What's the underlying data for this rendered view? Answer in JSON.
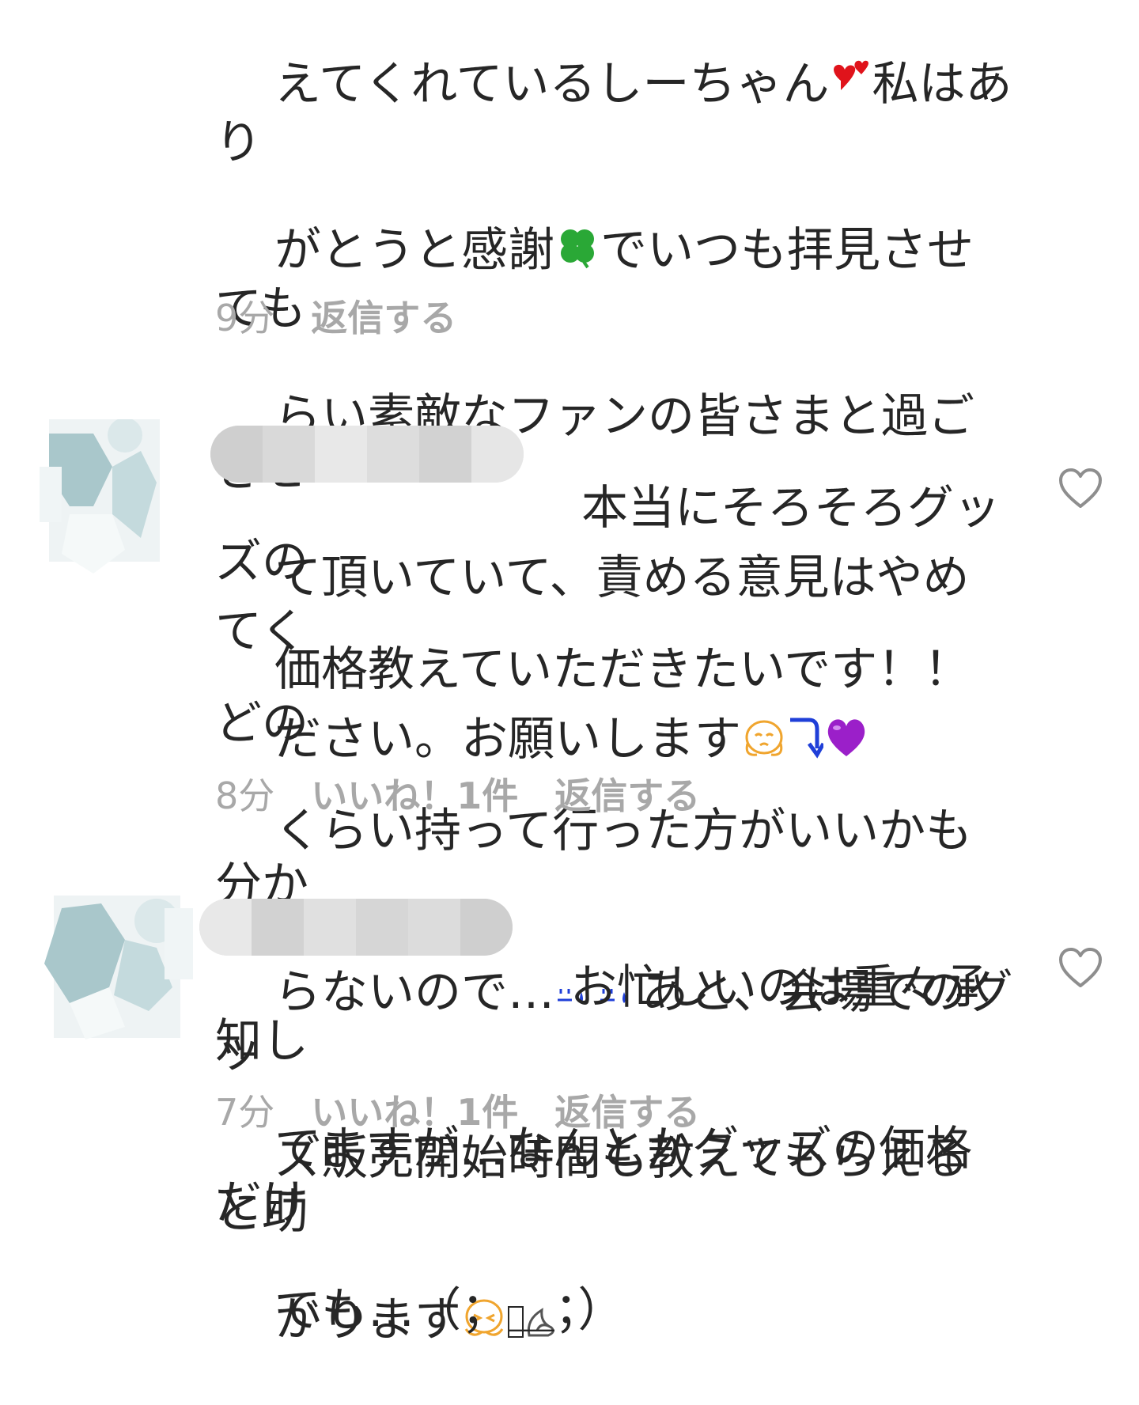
{
  "comments": [
    {
      "text_lines": [
        "えてくれているしーちゃん",
        "私はあり",
        "がとうと感謝",
        "でいつも拝見させても",
        "らい素敵なファンの皆さまと過ごさせ",
        "て頂いていて、責める意見はやめてく",
        "ださい。お願いします"
      ],
      "time": "9分",
      "reply": "返信する"
    },
    {
      "text_lines": [
        "本当にそろそろグッズの",
        "価格教えていただきたいです！！どの",
        "くらい持って行った方がいいかも分か",
        "らないので…",
        "あと、会場でのグッ",
        "ズ販売開始時間も教えてもらえると助",
        "かります"
      ],
      "time": "8分",
      "likes": "いいね！1件",
      "reply": "返信する"
    },
    {
      "text_lines": [
        "お忙しいのは重々承知し",
        "てますが…なんとかグッズの価格だけ",
        "でも…（；＿；）"
      ],
      "time": "7分",
      "likes": "いいね！1件",
      "reply": "返信する"
    }
  ],
  "colors": {
    "text": "#262626",
    "meta": "#a8a8a8",
    "heart_outline": "#8e8e8e",
    "red_heart": "#e0131b",
    "clover": "#2aa836",
    "purple_heart": "#9b1fc9",
    "arrow_blue": "#1f3fd8",
    "face_orange": "#f0a52e"
  },
  "icons": [
    "two-hearts-icon",
    "clover-icon",
    "pleading-face-icon",
    "curve-down-arrow-icon",
    "purple-heart-icon",
    "sweat-face-icon",
    "crying-face-icon",
    "dash-icon",
    "heart-outline-icon"
  ]
}
